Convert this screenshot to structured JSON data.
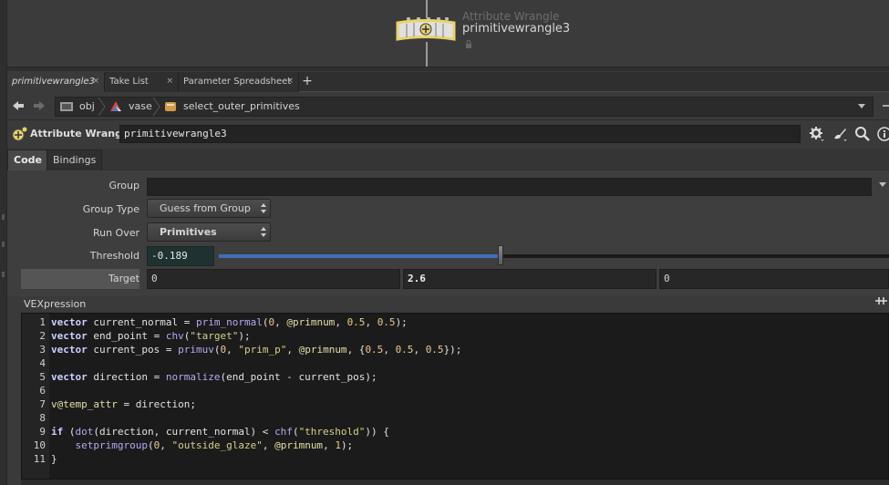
{
  "network": {
    "node_type_label": "Attribute Wrangle",
    "node_name": "primitivewrangle3"
  },
  "tabs": [
    {
      "label": "primitivewrangle3",
      "active": true
    },
    {
      "label": "Take List",
      "active": false
    },
    {
      "label": "Parameter Spreadsheet",
      "active": false
    }
  ],
  "tab_close_glyph": "×",
  "tab_add_glyph": "+",
  "path": {
    "crumbs": [
      "obj",
      "vase",
      "select_outer_primitives"
    ]
  },
  "header": {
    "op_type": "Attribute Wrangle",
    "op_name": "primitivewrangle3"
  },
  "subtabs": [
    {
      "label": "Code",
      "active": true
    },
    {
      "label": "Bindings",
      "active": false
    }
  ],
  "params": {
    "group_label": "Group",
    "group_value": "",
    "group_type_label": "Group Type",
    "group_type_value": "Guess from Group",
    "run_over_label": "Run Over",
    "run_over_value": "Primitives",
    "threshold_label": "Threshold",
    "threshold_value": "-0.189",
    "threshold_slider_fraction": 0.42,
    "target_label": "Target",
    "target_values": [
      "0",
      "2.6",
      "0"
    ]
  },
  "vex": {
    "label": "VEXpression",
    "line_numbers": [
      "1",
      "2",
      "3",
      "4",
      "5",
      "6",
      "7",
      "8",
      "9",
      "10",
      "11"
    ],
    "lines": [
      "vector current_normal = prim_normal(0, @primnum, 0.5, 0.5);",
      "vector end_point = chv(\"target\");",
      "vector current_pos = primuv(0, \"prim_p\", @primnum, {0.5, 0.5, 0.5});",
      "",
      "vector direction = normalize(end_point - current_pos);",
      "",
      "v@temp_attr = direction;",
      "",
      "if (dot(direction, current_normal) < chf(\"threshold\")) {",
      "    setprimgroup(0, \"outside_glaze\", @primnum, 1);",
      "}"
    ]
  },
  "icons": {
    "node": "wrangle-node-icon",
    "lock": "lock-icon",
    "back": "back-arrow-icon",
    "forward": "forward-arrow-icon",
    "obj": "obj-network-icon",
    "vase": "vase-geometry-icon",
    "sop": "sop-node-icon",
    "gear": "gear-icon",
    "brush": "brush-icon",
    "search": "search-icon",
    "info": "info-icon"
  },
  "colors": {
    "slider_fill": "#3f6fb6",
    "threshold_bg": "#1f3131",
    "node_yellow": "#e8d36a"
  }
}
